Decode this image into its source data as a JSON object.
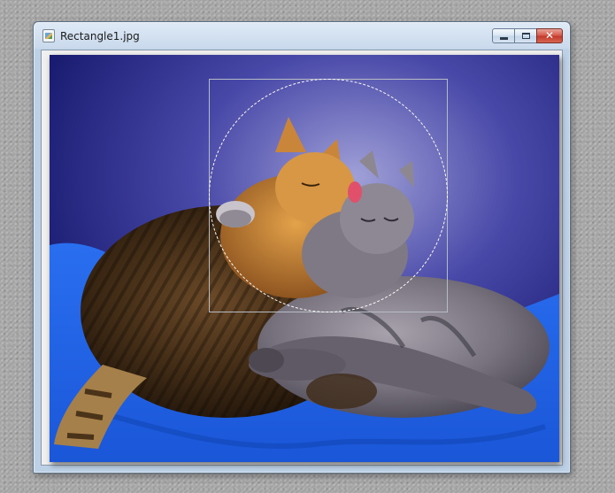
{
  "window": {
    "title": "Rectangle1.jpg",
    "buttons": {
      "minimize": "minimize-icon",
      "maximize": "maximize-icon",
      "close": "close-icon"
    }
  },
  "image": {
    "subject": "cat-photo",
    "selection_tool": "ellipse-selection"
  },
  "colors": {
    "close_button": "#c23a2b",
    "title_bar": "#c9d9ec",
    "background_blue": "#1c5fe0"
  }
}
